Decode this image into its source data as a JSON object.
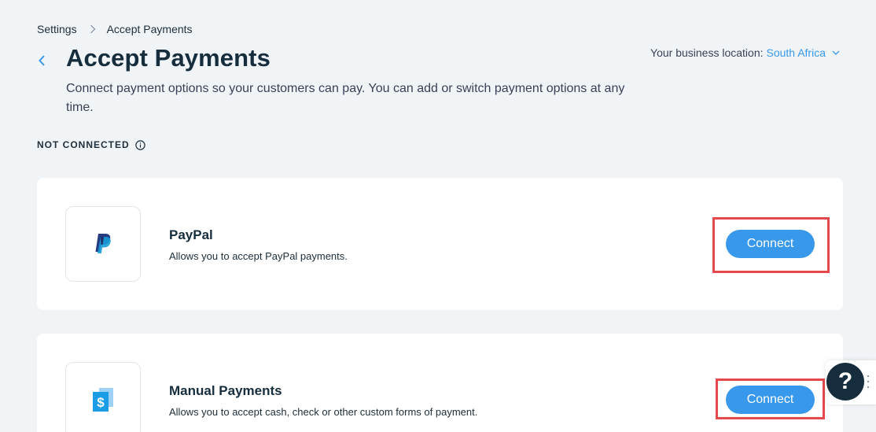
{
  "breadcrumb": {
    "items": [
      "Settings",
      "Accept Payments"
    ]
  },
  "header": {
    "title": "Accept Payments",
    "subtitle": "Connect payment options so your customers can pay. You can add or switch payment options at any time.",
    "location_label": "Your business location:",
    "location_value": "South Africa"
  },
  "section": {
    "label": "NOT CONNECTED"
  },
  "providers": [
    {
      "name": "PayPal",
      "description": "Allows you to accept PayPal payments.",
      "button_label": "Connect",
      "icon": "paypal-logo-icon"
    },
    {
      "name": "Manual Payments",
      "description": "Allows you to accept cash, check or other custom forms of payment.",
      "button_label": "Connect",
      "icon": "dollar-document-icon"
    }
  ],
  "help": {
    "label": "?"
  },
  "colors": {
    "accent": "#3899ec",
    "highlight": "#e5484d",
    "background": "#f0f4f7",
    "title": "#162d3d"
  }
}
